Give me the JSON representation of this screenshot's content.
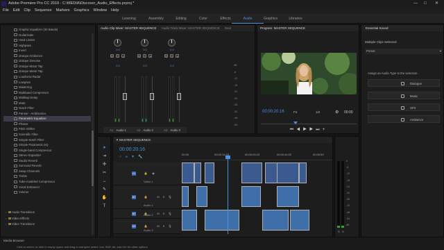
{
  "window": {
    "title": "Adobe Premiere Pro CC 2019 - C:\\MEDIA\\Discover_Audio_Effects.prproj *",
    "controls": [
      "—",
      "□",
      "✕"
    ]
  },
  "menu": [
    "File",
    "Edit",
    "Clip",
    "Sequence",
    "Markers",
    "Graphics",
    "Window",
    "Help"
  ],
  "workspaces": {
    "tabs": [
      "Learning",
      "Assembly",
      "Editing",
      "Color",
      "Effects",
      "Audio",
      "Graphics",
      "Libraries"
    ],
    "active": "Audio"
  },
  "effects_panel": {
    "items": [
      "Graphic Equalizer (30 Bands)",
      "GuitarSuite",
      "Hard Limiter",
      "Highpass",
      "Invert",
      "iZotope Ambience",
      "iZotope Denoise",
      "iZotope Motor Tap",
      "iZotope Meter Tap",
      "Loudness Radar",
      "Lowpass",
      "Mastering",
      "Multiband Compressor",
      "Multitap Delay",
      "Mute",
      "Notch Filter",
      "Panner - Ambisonics",
      "Parametric Equalizer",
      "Phaser",
      "Pitch Shifter",
      "Scientific Filter",
      "Simple Notch Filter",
      "Simple Parametric EQ",
      "Single-band Compressor",
      "Stereo Expander",
      "Studio Reverb",
      "Surround Reverb",
      "Swap Channels",
      "Treble",
      "Tube-modeled Compressor",
      "Vocal Enhancer",
      "Volume"
    ],
    "selected_index": 17,
    "folders": [
      "Audio Transitions",
      "Video Effects",
      "Video Transitions"
    ],
    "footer": "Media Browser"
  },
  "mixer": {
    "tabs": [
      "Audio Clip Mixer: MASTER SEQUENCE",
      "Audio Track Mixer: MASTER SEQUENCE",
      "Sour"
    ],
    "channels": [
      {
        "id": "A1",
        "name": "Audio 1",
        "value": "0.0"
      },
      {
        "id": "A2",
        "name": "Audio 2",
        "value": "0.0"
      },
      {
        "id": "A3",
        "name": "Audio 3",
        "value": "0.0"
      }
    ],
    "scale": [
      "dB",
      "-6",
      "-12",
      "-18",
      "-24",
      "-30",
      "-36",
      "-42",
      "-48",
      "-54"
    ]
  },
  "program_monitor": {
    "tab": "Program: MASTER SEQUENCE",
    "timecode": "00:00:20:16",
    "zoom": "Fit",
    "resolution": "1/2",
    "end_timecode": "00:00"
  },
  "essential_sound": {
    "tab": "Essential Sound",
    "subtitle": "Multiple Clips Selected",
    "preset_label": "Preset",
    "assign_text": "Assign an Audio Type to the selection",
    "types": [
      "Dialogue",
      "Music",
      "SFX",
      "Ambience"
    ]
  },
  "timeline": {
    "tab": "MASTER SEQUENCE",
    "timecode": "00:00:20:16",
    "ruler": [
      ":00:00",
      "00:00:14:23",
      "00:00:29:23",
      "00:00:44:22",
      "00:00:59"
    ],
    "tracks": [
      {
        "id": "V1",
        "name": "Video 1"
      },
      {
        "id": "A1",
        "name": "Audio 1"
      },
      {
        "id": "A2",
        "name": "Audio 2"
      },
      {
        "id": "A3",
        "name": "Audio 3"
      }
    ],
    "buttons": {
      "mute": "M",
      "solo": "S"
    }
  },
  "audio_meter": {
    "scale": [
      "0",
      "-6",
      "-12",
      "-18",
      "-24",
      "-30",
      "-36",
      "-42",
      "-48",
      "-54",
      "dB"
    ],
    "channels": [
      "S",
      "S"
    ]
  },
  "status": {
    "text": "Click to select, or click in empty space and drag to marquee select. Use Shift, Alt, and Ctrl for other options."
  },
  "icons": [
    "premiere-icon",
    "selection-tool-icon",
    "track-select-icon",
    "ripple-edit-icon",
    "razor-icon",
    "slip-icon",
    "pen-icon",
    "hand-icon",
    "type-icon"
  ],
  "colors": {
    "accent": "#4f8fe0",
    "clip_audio": "#3f6fa8",
    "clip_video": "#3b5a8f",
    "meter_green": "#2ea32e"
  }
}
